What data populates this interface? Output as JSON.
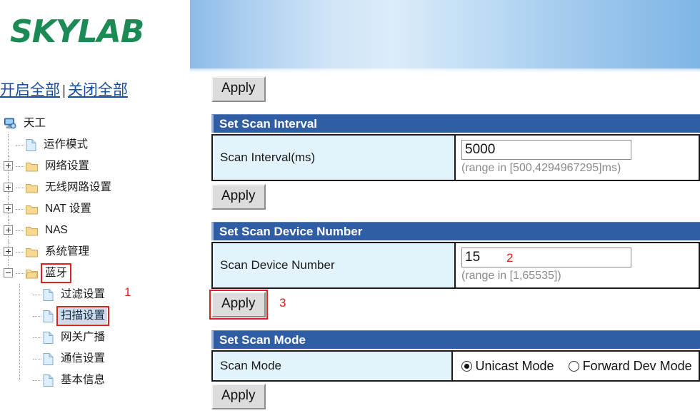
{
  "brand": {
    "logo_text": "SKYLAB"
  },
  "sidebar": {
    "expand_all_label": "开启全部",
    "separator": "|",
    "collapse_all_label": "关闭全部",
    "root": {
      "label": "天工",
      "icon": "computer-icon"
    },
    "items": [
      {
        "label": "运作模式",
        "icon": "page-icon",
        "toggle": "none",
        "level": 1,
        "selected": false
      },
      {
        "label": "网络设置",
        "icon": "folder-icon",
        "toggle": "plus",
        "level": 1,
        "selected": false
      },
      {
        "label": "无线网路设置",
        "icon": "folder-icon",
        "toggle": "plus",
        "level": 1,
        "selected": false
      },
      {
        "label": "NAT 设置",
        "icon": "folder-icon",
        "toggle": "plus",
        "level": 1,
        "selected": false
      },
      {
        "label": "NAS",
        "icon": "folder-icon",
        "toggle": "plus",
        "level": 1,
        "selected": false
      },
      {
        "label": "系统管理",
        "icon": "folder-icon",
        "toggle": "plus",
        "level": 1,
        "selected": false
      },
      {
        "label": "蓝牙",
        "icon": "folder-open-icon",
        "toggle": "minus",
        "level": 1,
        "selected": false,
        "highlighted": true
      },
      {
        "label": "过滤设置",
        "icon": "page-icon",
        "toggle": "none",
        "level": 2,
        "selected": false
      },
      {
        "label": "扫描设置",
        "icon": "page-icon",
        "toggle": "none",
        "level": 2,
        "selected": true,
        "highlighted": true
      },
      {
        "label": "网关广播",
        "icon": "page-icon",
        "toggle": "none",
        "level": 2,
        "selected": false
      },
      {
        "label": "通信设置",
        "icon": "page-icon",
        "toggle": "none",
        "level": 2,
        "selected": false
      },
      {
        "label": "基本信息",
        "icon": "page-icon",
        "toggle": "none",
        "level": 2,
        "selected": false
      }
    ]
  },
  "main": {
    "top_apply_label": "Apply",
    "sections": [
      {
        "title": "Set Scan Interval",
        "field_label": "Scan Interval(ms)",
        "value": "5000",
        "hint": "(range in [500,4294967295]ms)",
        "apply_label": "Apply"
      },
      {
        "title": "Set Scan Device Number",
        "field_label": "Scan Device Number",
        "value": "15",
        "hint": "(range in [1,65535])",
        "apply_label": "Apply"
      },
      {
        "title": "Set Scan Mode",
        "field_label": "Scan Mode",
        "apply_label": "Apply",
        "options": [
          {
            "label": "Unicast Mode",
            "selected": true
          },
          {
            "label": "Forward Dev Mode",
            "selected": false
          }
        ]
      }
    ]
  },
  "annotations": {
    "step1": "1",
    "step2": "2",
    "step3": "3",
    "color": "#d82020"
  }
}
